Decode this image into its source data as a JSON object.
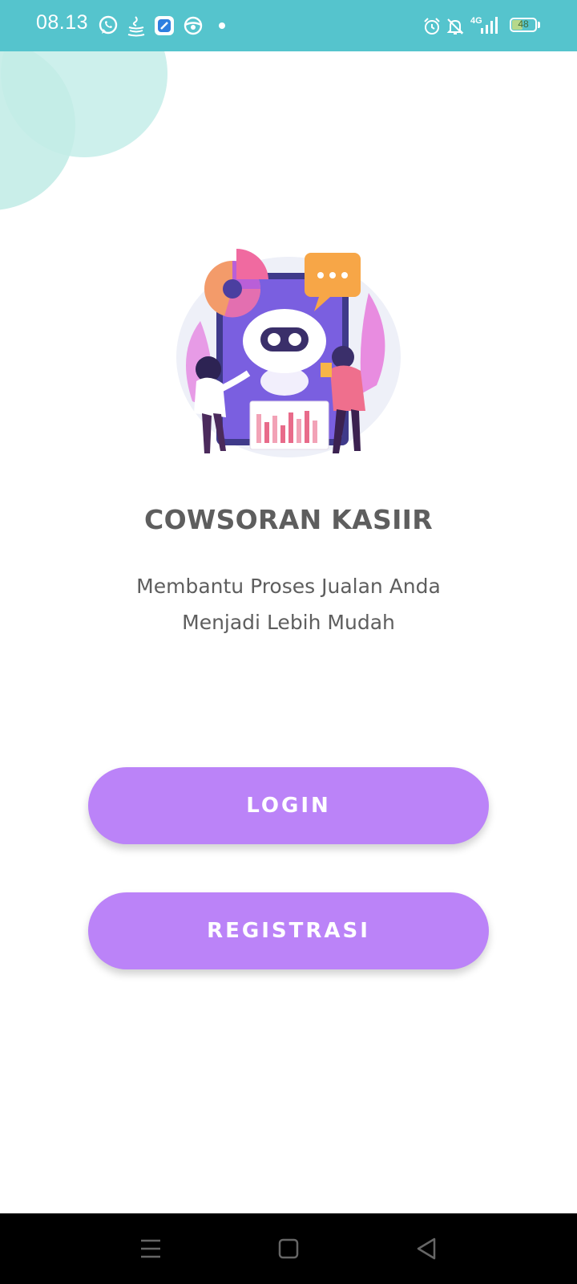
{
  "status_bar": {
    "time": "08.13",
    "left_icons": [
      "whatsapp-icon",
      "java-icon",
      "app-icon",
      "steering-wheel-icon",
      "dot-icon"
    ],
    "right_icons": [
      "alarm-icon",
      "mute-icon",
      "4g-signal-icon"
    ],
    "network": "4G",
    "battery": "48",
    "battery_level": 0.48
  },
  "main": {
    "illustration": "robot-chat-illustration",
    "title": "COWSORAN KASIIR",
    "tagline_line1": "Membantu Proses Jualan Anda",
    "tagline_line2": "Menjadi Lebih Mudah"
  },
  "buttons": {
    "login": "LOGIN",
    "register": "REGISTRASI"
  },
  "colors": {
    "status_bar": "#55c4cd",
    "button": "#bb83f8",
    "text": "#5e5e5e",
    "deco_circle": "#cdf0ec"
  },
  "nav_bar": {
    "icons": [
      "menu-icon",
      "home-icon",
      "back-icon"
    ]
  }
}
